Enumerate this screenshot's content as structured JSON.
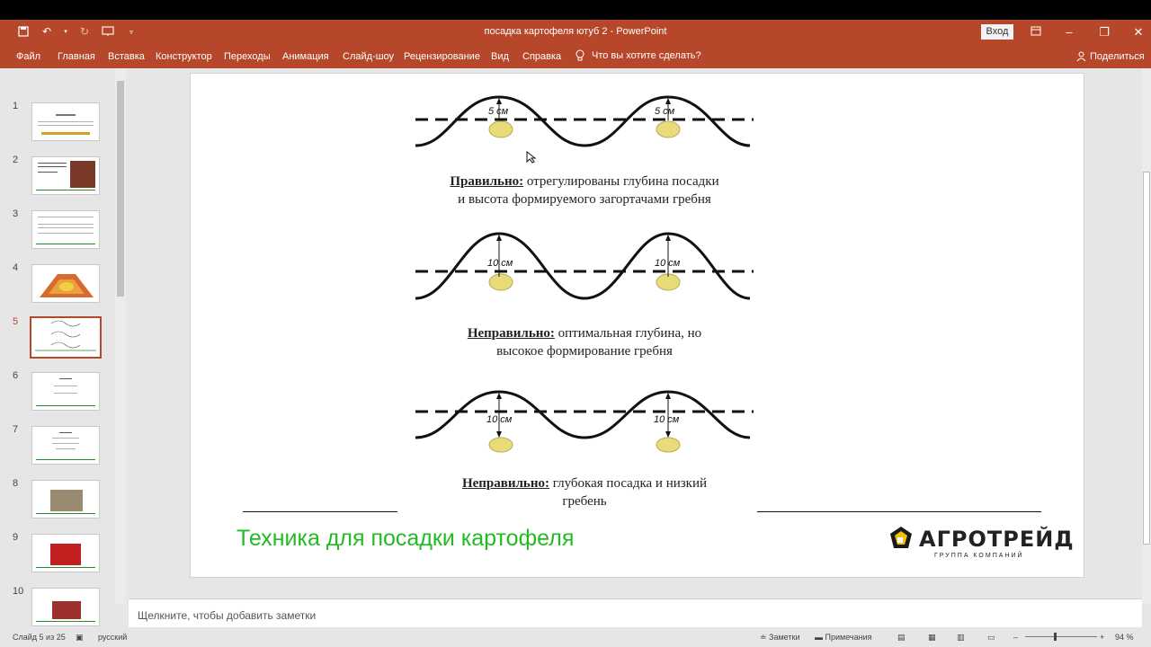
{
  "window": {
    "title": "посадка картофеля ютуб 2  -  PowerPoint",
    "login_label": "Вход",
    "colors": {
      "accent": "#b7472a",
      "green_title": "#22bb22"
    }
  },
  "ribbon": {
    "tabs": [
      "Файл",
      "Главная",
      "Вставка",
      "Конструктор",
      "Переходы",
      "Анимация",
      "Слайд-шоу",
      "Рецензирование",
      "Вид",
      "Справка"
    ],
    "tell_me": "Что вы хотите сделать?",
    "share": "Поделиться"
  },
  "thumbnails": {
    "numbers": [
      "1",
      "2",
      "3",
      "4",
      "5",
      "6",
      "7",
      "8",
      "9",
      "10"
    ],
    "active_index": 5
  },
  "slide": {
    "diagram_label_5": "5 см",
    "diagram_label_10": "10 см",
    "caption1_bold": "Правильно:",
    "caption1_line1": " отрегулированы глубина посадки",
    "caption1_line2": "и высота формируемого загортачами гребня",
    "caption2_bold": "Неправильно:",
    "caption2_line1": " оптимальная глубина, но",
    "caption2_line2": "высокое формирование гребня",
    "caption3_bold": "Неправильно:",
    "caption3_line1": " глубокая посадка и низкий",
    "caption3_line2": "гребень",
    "footer_title": "Техника для посадки картофеля",
    "logo_name": "АГРОТРЕЙД",
    "logo_sub": "ГРУППА КОМПАНИЙ"
  },
  "notes": {
    "placeholder": "Щелкните, чтобы добавить заметки"
  },
  "status": {
    "slide_info": "Слайд 5 из 25",
    "language": "русский",
    "notes_btn": "Заметки",
    "comments_btn": "Примечания",
    "zoom": "94 %"
  }
}
